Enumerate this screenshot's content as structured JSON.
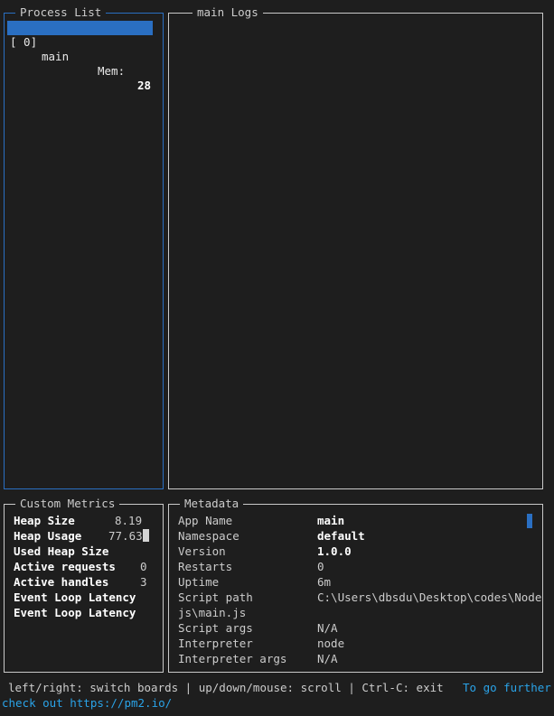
{
  "process_list": {
    "title": "Process List",
    "row": {
      "index": "[ 0]",
      "name": "main",
      "mem_label": "Mem:",
      "mem_value": "28"
    }
  },
  "logs": {
    "title": "main Logs"
  },
  "custom_metrics": {
    "title": "Custom Metrics",
    "items": [
      {
        "label": "Heap Size",
        "value": "8.19"
      },
      {
        "label": "Heap Usage",
        "value": "77.63"
      },
      {
        "label": "Used Heap Size",
        "value": ""
      },
      {
        "label": "Active requests",
        "value": "0"
      },
      {
        "label": "Active handles",
        "value": "3"
      },
      {
        "label": "Event Loop Latency",
        "value": ""
      },
      {
        "label": "Event Loop Latency",
        "value": ""
      }
    ]
  },
  "metadata": {
    "title": "Metadata",
    "items": [
      {
        "label": "App Name",
        "value": "main"
      },
      {
        "label": "Namespace",
        "value": "default"
      },
      {
        "label": "Version",
        "value": "1.0.0"
      },
      {
        "label": "Restarts",
        "value": "0"
      },
      {
        "label": "Uptime",
        "value": "6m"
      },
      {
        "label": "Script path",
        "value": "C:\\Users\\dbsdu\\Desktop\\codes\\Node"
      },
      {
        "label": "js\\main.js",
        "value": ""
      },
      {
        "label": "Script args",
        "value": "N/A"
      },
      {
        "label": "Interpreter",
        "value": "node"
      },
      {
        "label": "Interpreter args",
        "value": "N/A"
      }
    ]
  },
  "footer": {
    "help": "left/right: switch boards | up/down/mouse: scroll | Ctrl-C: exit",
    "further": "To go further",
    "check_out": "check out https://pm2.io/"
  },
  "colors": {
    "accent": "#2a6fc2",
    "link": "#2aa3e8",
    "background": "#1e1e1e",
    "border": "#c9c9c9"
  }
}
